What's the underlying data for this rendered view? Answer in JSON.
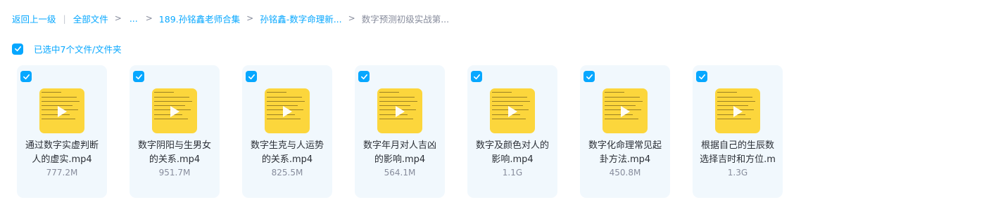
{
  "breadcrumb": {
    "back": "返回上一级",
    "all_files": "全部文件",
    "ellipsis": "...",
    "crumb1": "189.孙铭鑫老师合集",
    "crumb2": "孙铭鑫-数字命理新...",
    "current": "数字预测初级实战第..."
  },
  "selection": {
    "label": "已选中7个文件/文件夹",
    "checked": true
  },
  "files": [
    {
      "name": "通过数字实虚判断人的虚实.mp4",
      "size": "777.2M",
      "type_icon": "video-thumbnail"
    },
    {
      "name": "数字阴阳与生男女的关系.mp4",
      "size": "951.7M",
      "type_icon": "video-thumbnail"
    },
    {
      "name": "数字生克与人运势的关系.mp4",
      "size": "825.5M",
      "type_icon": "video-thumbnail"
    },
    {
      "name": "数字年月对人吉凶的影响.mp4",
      "size": "564.1M",
      "type_icon": "video-thumbnail"
    },
    {
      "name": "数字及颜色对人的影响.mp4",
      "size": "1.1G",
      "type_icon": "video-thumbnail"
    },
    {
      "name": "数字化命理常见起卦方法.mp4",
      "size": "450.8M",
      "type_icon": "video-thumbnail"
    },
    {
      "name": "根据自己的生辰数选择吉时和方位.m",
      "size": "1.3G",
      "type_icon": "video-thumbnail"
    }
  ],
  "colors": {
    "accent": "#06a7ff",
    "card_bg": "#f1f8fd",
    "thumb_bg": "#fcd63c",
    "muted": "#878c9c"
  }
}
